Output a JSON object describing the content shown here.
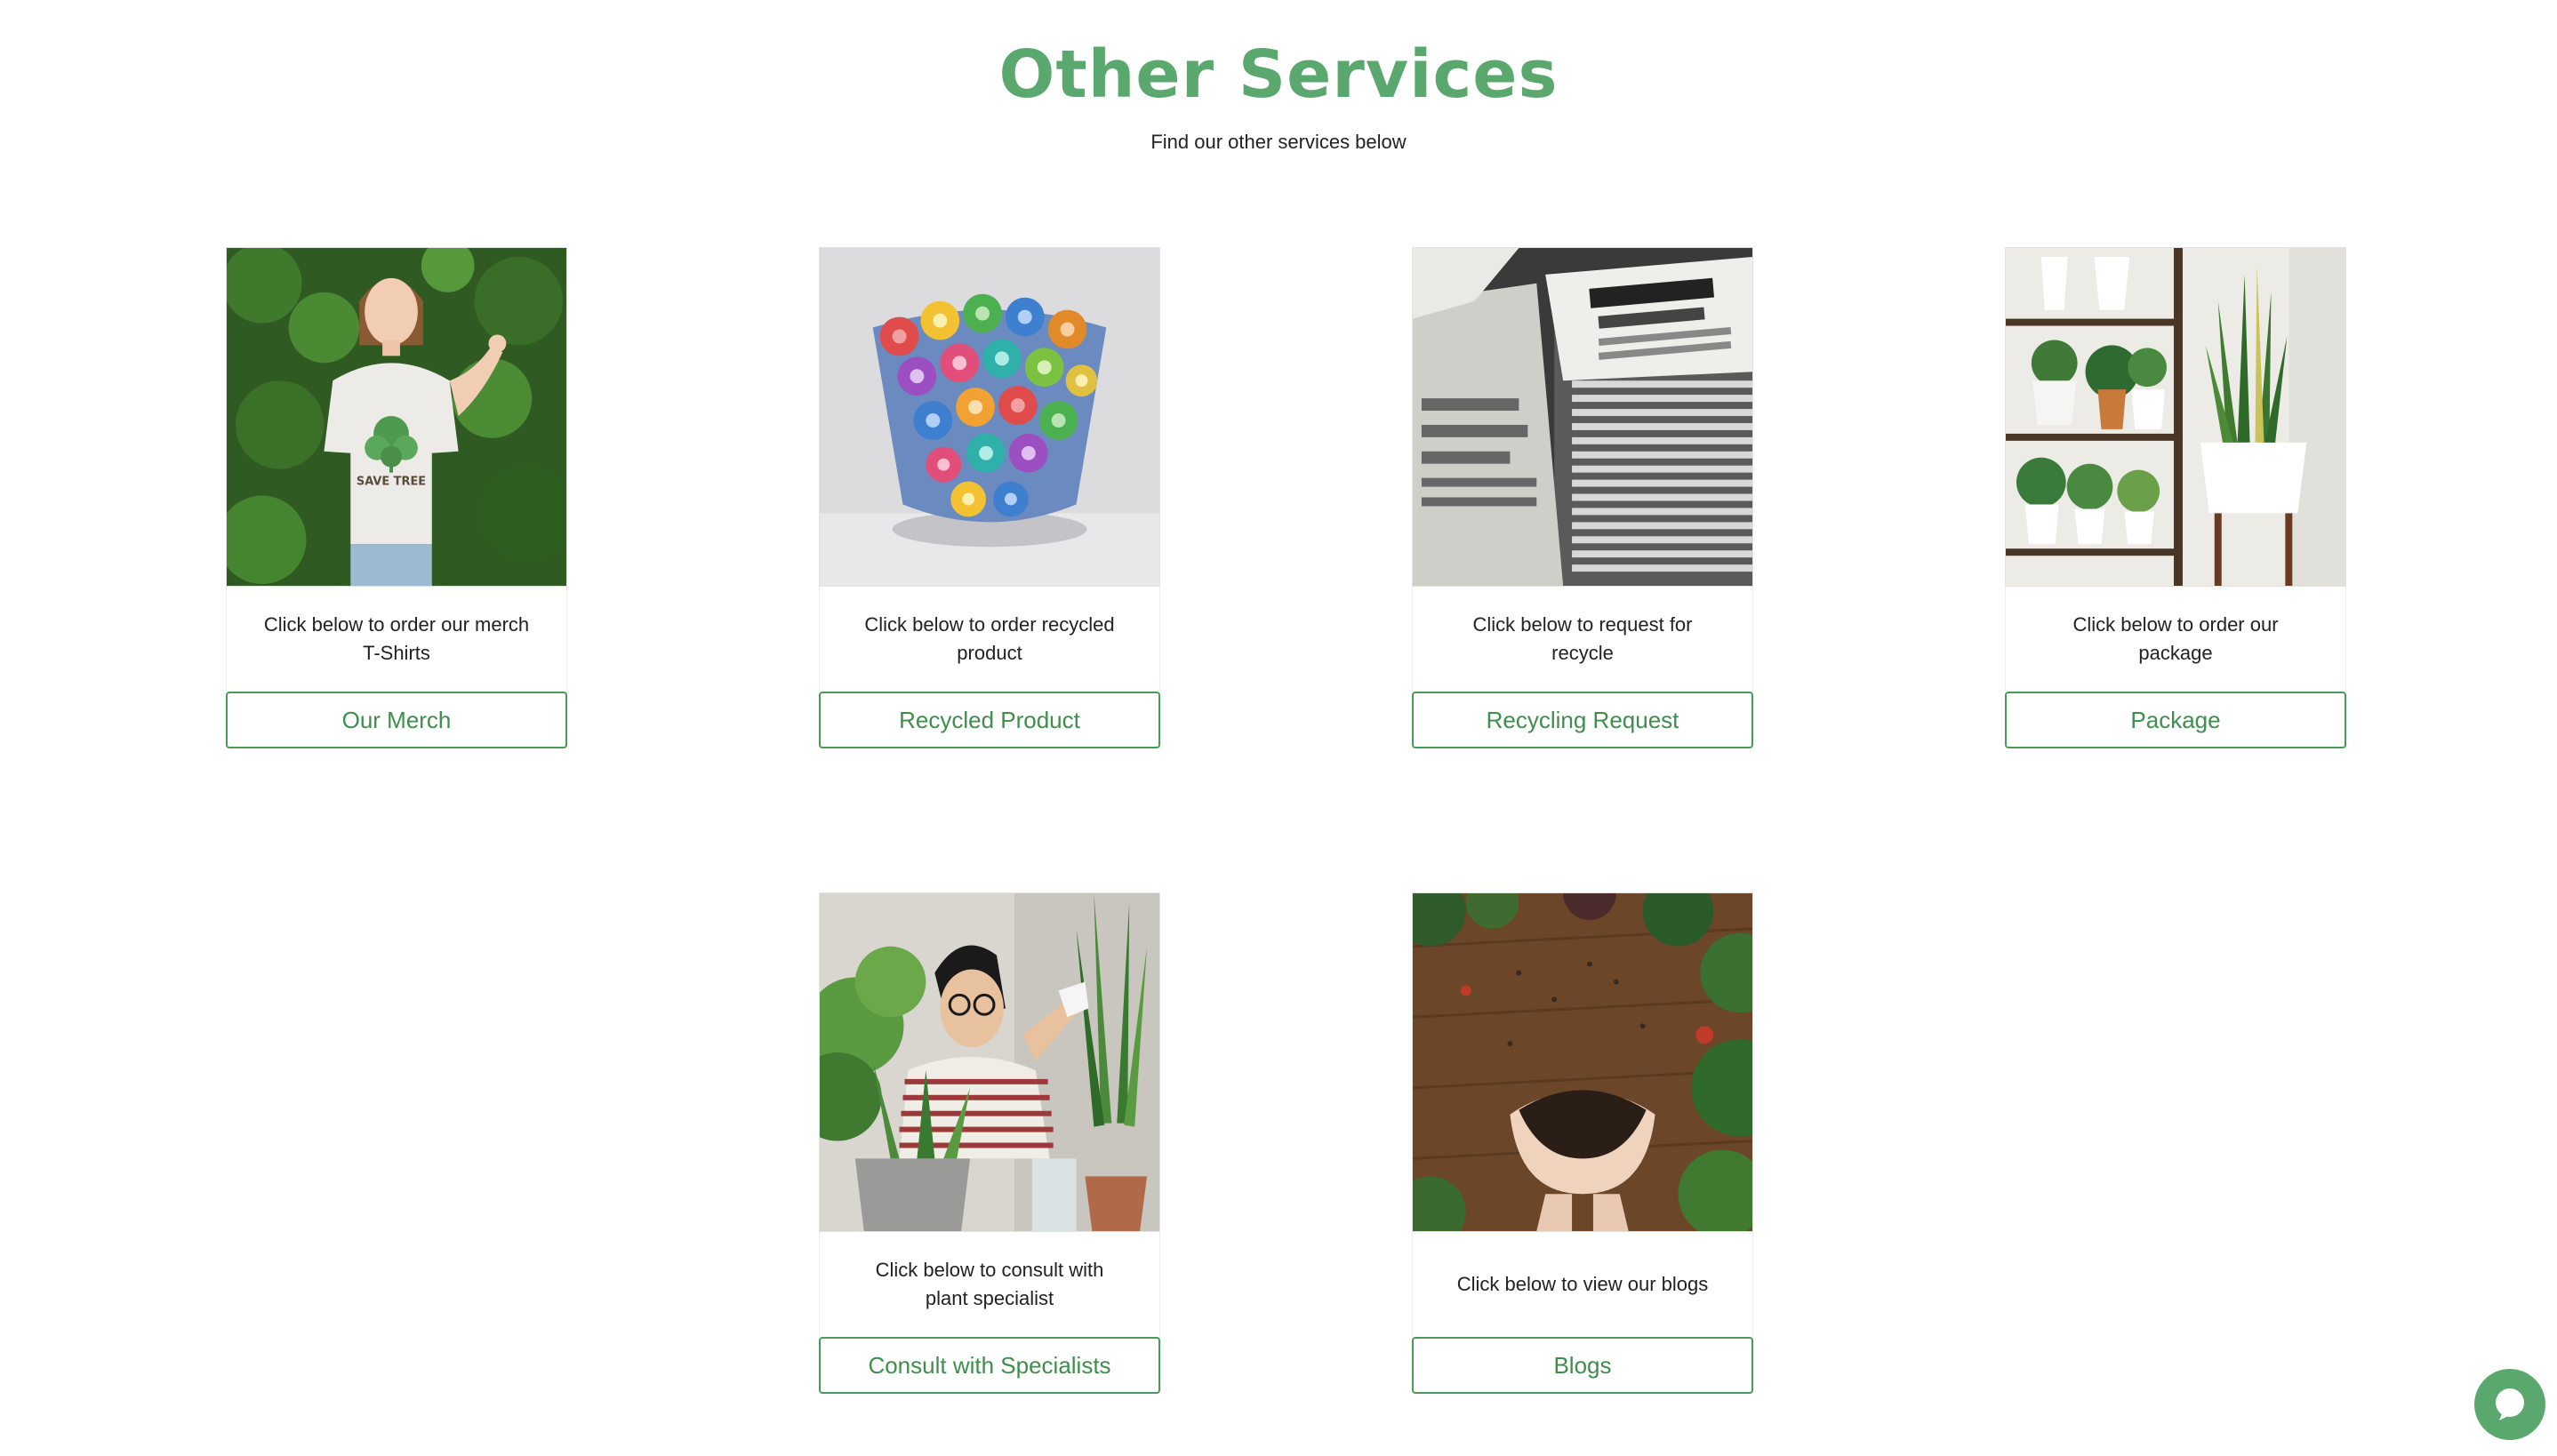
{
  "header": {
    "title": "Other Services",
    "subtitle": "Find our other services below"
  },
  "cards": [
    {
      "text": "Click below to order our merch T-Shirts",
      "button_label": "Our Merch",
      "image_icon": "girl-in-tshirt-photo",
      "tshirt_print": "SAVE TREE"
    },
    {
      "text": "Click below to order recycled product",
      "button_label": "Recycled Product",
      "image_icon": "recycled-paper-vase-photo"
    },
    {
      "text": "Click below to request for recycle",
      "button_label": "Recycling Request",
      "image_icon": "newspaper-stack-photo"
    },
    {
      "text": "Click below to order our package",
      "button_label": "Package",
      "image_icon": "potted-plants-photo"
    },
    {
      "text": "Click below to consult with plant specialist",
      "button_label": "Consult with Specialists",
      "image_icon": "plant-specialist-photo"
    },
    {
      "text": "Click below to view our blogs",
      "button_label": "Blogs",
      "image_icon": "hands-holding-soil-photo"
    }
  ],
  "chat": {
    "icon": "chat-bubble-icon"
  },
  "colors": {
    "accent": "#5aa86d",
    "button_text": "#3e8e4c",
    "button_border": "#4c9a5a"
  }
}
